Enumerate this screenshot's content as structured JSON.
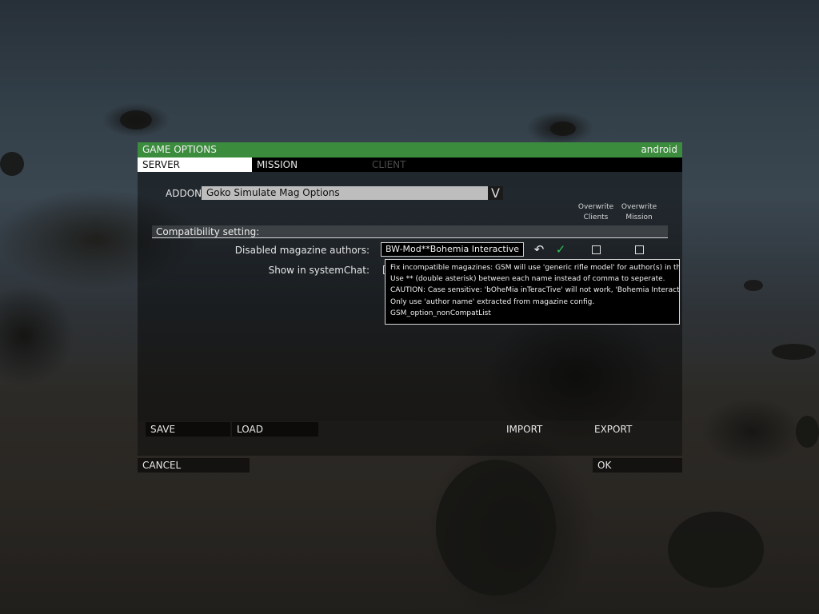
{
  "dialog": {
    "title": "GAME OPTIONS",
    "profile_name": "android"
  },
  "tabs": [
    {
      "label": "SERVER",
      "state": "active"
    },
    {
      "label": "MISSION",
      "state": "normal"
    },
    {
      "label": "CLIENT",
      "state": "disabled"
    }
  ],
  "addon": {
    "label": "ADDON:",
    "selected": "Goko Simulate Mag Options",
    "dropdown_glyph": "V"
  },
  "columns": {
    "overwrite_clients": "Overwrite Clients",
    "overwrite_mission": "Overwrite Mission"
  },
  "section": {
    "title": "Compatibility setting:"
  },
  "settings": [
    {
      "label": "Disabled magazine authors:",
      "value": "BW-Mod**Bohemia Interactive",
      "reset_icon": "undo-arrow-icon",
      "apply_icon": "checkmark-icon",
      "overwrite_clients": false,
      "overwrite_mission": false
    },
    {
      "label": "Show in systemChat:",
      "checked": false
    }
  ],
  "tooltip": {
    "lines": [
      "Fix incompatible magazines: GSM will use 'generic rifle model' for author(s) in this list.",
      "Use ** (double asterisk) between each name instead of comma to seperate.",
      "CAUTION: Case sensitive: 'bOheMia inTeracTive' will not work, 'Bohemia Interactive' will.",
      "Only use 'author name' extracted from magazine config.",
      "GSM_option_nonCompatList"
    ]
  },
  "footer": {
    "save": "SAVE",
    "load": "LOAD",
    "import": "IMPORT",
    "export": "EXPORT",
    "cancel": "CANCEL",
    "ok": "OK"
  },
  "colors": {
    "header_green": "#3c8c3e",
    "apply_green": "#2fc35b",
    "tab_active_bg": "#ffffff",
    "select_bg": "#bdbdbd"
  }
}
